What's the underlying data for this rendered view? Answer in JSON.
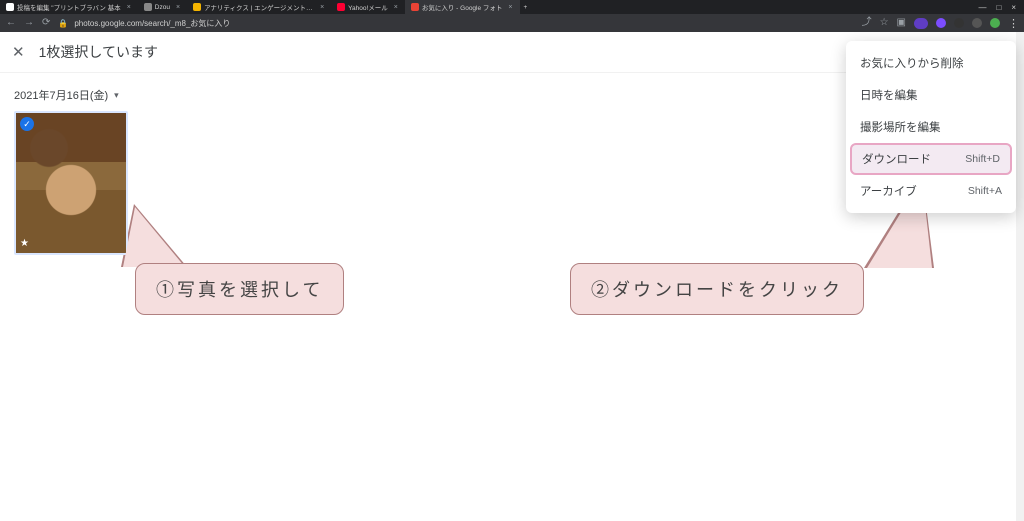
{
  "browser": {
    "tabs": [
      {
        "label": "投稿を編集 \"プリントブラバン 基本",
        "fav": "#ffffff"
      },
      {
        "label": "Dzou",
        "fav": "#888888"
      },
      {
        "label": "アナリティクス | エンゲージメントの概要",
        "fav": "#f4b400"
      },
      {
        "label": "Yahoo!メール",
        "fav": "#ff0033"
      },
      {
        "label": "お気に入り - Google フォト",
        "fav": "#ea4335",
        "active": true
      }
    ],
    "url": "photos.google.com/search/_m8_お気に入り"
  },
  "header": {
    "selection_text": "1枚選択しています"
  },
  "date_group": {
    "label": "2021年7月16日(金)"
  },
  "menu": {
    "items": [
      {
        "label": "お気に入りから削除",
        "shortcut": ""
      },
      {
        "label": "日時を編集",
        "shortcut": ""
      },
      {
        "label": "撮影場所を編集",
        "shortcut": ""
      },
      {
        "label": "ダウンロード",
        "shortcut": "Shift+D",
        "highlight": true
      },
      {
        "label": "アーカイブ",
        "shortcut": "Shift+A"
      }
    ]
  },
  "callouts": {
    "c1": "①写真を選択して",
    "c2": "②ダウンロードをクリック"
  }
}
